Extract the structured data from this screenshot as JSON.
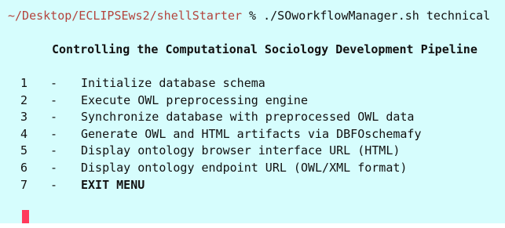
{
  "prompt": {
    "path": "~/Desktop/ECLIPSEws2/shellStarter",
    "symbol": "%",
    "command": "./SOworkflowManager.sh technical"
  },
  "heading": "Controlling the Computational Sociology Development Pipeline",
  "menu": {
    "items": [
      {
        "number": "1",
        "dash": "-",
        "label": "Initialize database schema"
      },
      {
        "number": "2",
        "dash": "-",
        "label": "Execute OWL preprocessing engine"
      },
      {
        "number": "3",
        "dash": "-",
        "label": "Synchronize database with preprocessed OWL data"
      },
      {
        "number": "4",
        "dash": "-",
        "label": "Generate OWL and HTML artifacts via DBFOschemafy"
      },
      {
        "number": "5",
        "dash": "-",
        "label": "Display ontology browser interface URL (HTML)"
      },
      {
        "number": "6",
        "dash": "-",
        "label": "Display ontology endpoint URL (OWL/XML format)"
      },
      {
        "number": "7",
        "dash": "-",
        "label": "EXIT MENU"
      }
    ]
  },
  "colors": {
    "background": "#d6fdfd",
    "prompt_path": "#b4443d",
    "cursor": "#ff3b5c"
  }
}
